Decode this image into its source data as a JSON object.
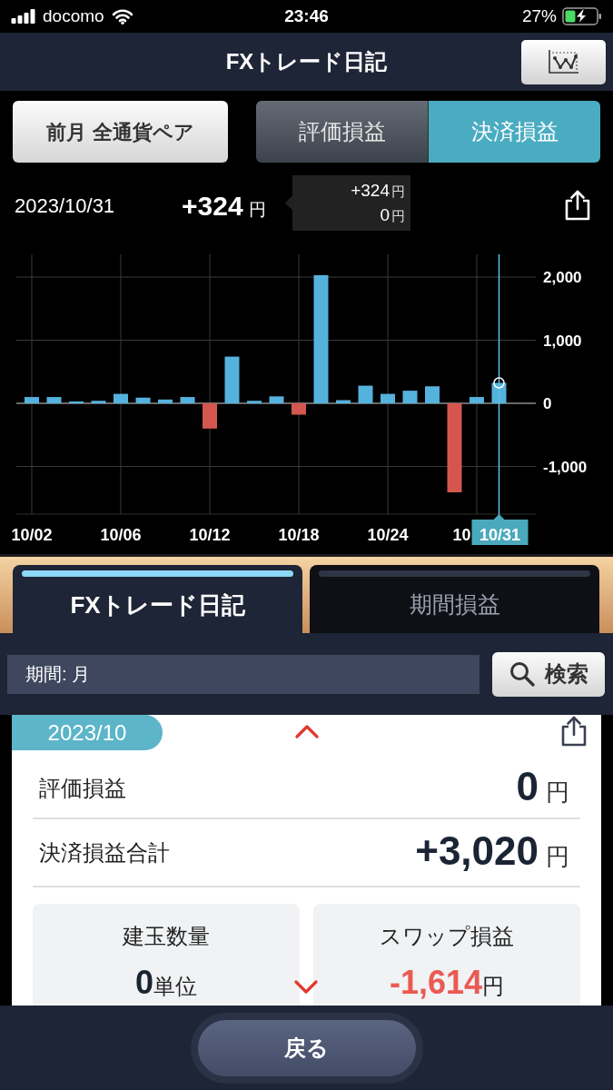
{
  "status_bar": {
    "carrier": "docomo",
    "time": "23:46",
    "battery": "27%"
  },
  "header": {
    "title": "FXトレード日記"
  },
  "filter_button": {
    "label": "前月 全通貨ペア"
  },
  "segments": [
    {
      "label": "評価損益",
      "selected": false
    },
    {
      "label": "決済損益",
      "selected": true
    }
  ],
  "selected_point": {
    "date": "2023/10/31",
    "value": "+324",
    "unit": "円"
  },
  "tooltip": {
    "rows": [
      {
        "value": "+324",
        "unit": "円"
      },
      {
        "value": "0",
        "unit": "円"
      }
    ]
  },
  "chart": {
    "chart_data": {
      "type": "bar",
      "categories": [
        "10/02",
        null,
        null,
        null,
        "10/06",
        null,
        null,
        null,
        "10/12",
        null,
        null,
        null,
        "10/18",
        null,
        null,
        null,
        "10/24",
        null,
        null,
        null,
        null,
        "10/31"
      ],
      "values": [
        100,
        100,
        30,
        40,
        150,
        90,
        60,
        100,
        -400,
        740,
        40,
        110,
        -180,
        2030,
        50,
        280,
        150,
        200,
        270,
        -1410,
        100,
        324
      ],
      "ylim": [
        -1755,
        2360
      ],
      "yticks": [
        {
          "value": 2000,
          "label": "2,000"
        },
        {
          "value": 1000,
          "label": "1,000"
        },
        {
          "value": 0,
          "label": "0"
        },
        {
          "value": -1000,
          "label": "-1,000"
        }
      ],
      "grid": true
    },
    "covered_label": "10",
    "bars": [
      {
        "selected": false
      },
      {
        "selected": false
      },
      {
        "selected": false
      },
      {
        "selected": false
      },
      {
        "selected": false
      },
      {
        "selected": false
      },
      {
        "selected": false
      },
      {
        "selected": false
      },
      {
        "selected": false
      },
      {
        "selected": false
      },
      {
        "selected": false
      },
      {
        "selected": false
      },
      {
        "selected": false
      },
      {
        "selected": false
      },
      {
        "selected": false
      },
      {
        "selected": false
      },
      {
        "selected": false
      },
      {
        "selected": false
      },
      {
        "selected": false
      },
      {
        "selected": false
      },
      {
        "selected": false
      },
      {
        "selected": true
      }
    ]
  },
  "tabs": [
    {
      "label": "FXトレード日記",
      "selected": true
    },
    {
      "label": "期間損益",
      "selected": false
    }
  ],
  "search": {
    "value": "期間: 月",
    "button": "検索"
  },
  "summary_card": {
    "badge": "2023/10",
    "rows": [
      {
        "label": "評価損益",
        "value": "0",
        "unit": "円"
      },
      {
        "label": "決済損益合計",
        "value": "+3,020",
        "unit": "円"
      }
    ],
    "tiles": [
      {
        "label": "建玉数量",
        "value": "0",
        "unit": "単位",
        "negative": false
      },
      {
        "label": "スワップ損益",
        "value": "-1,614",
        "unit": "円",
        "negative": true
      }
    ]
  },
  "footer": {
    "back_button": "戻る"
  }
}
